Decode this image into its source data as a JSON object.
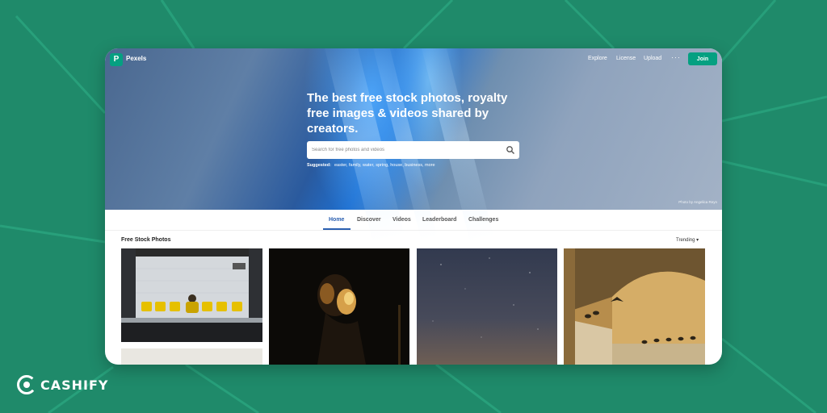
{
  "brand": {
    "name": "Pexels",
    "logo_letter": "P",
    "accent_color": "#05a081"
  },
  "nav": {
    "links": [
      "Explore",
      "License",
      "Upload"
    ],
    "more": "···",
    "join": "Join"
  },
  "hero": {
    "headline": "The best free stock photos, royalty free images & videos shared by creators.",
    "search_placeholder": "Search for free photos and videos",
    "suggested_label": "Suggested:",
    "suggested_terms": "easter, family, water, spring, house, business, more",
    "photo_credit": "Photo by Angelica Reyn"
  },
  "tabs": {
    "items": [
      "Home",
      "Discover",
      "Videos",
      "Leaderboard",
      "Challenges"
    ],
    "active": "Home"
  },
  "gallery": {
    "title": "Free Stock Photos",
    "sort": "Trending"
  },
  "watermark": {
    "text": "CASHIFY"
  }
}
